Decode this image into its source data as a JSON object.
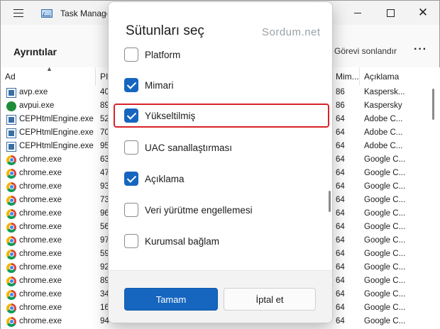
{
  "window": {
    "title": "Task Manage",
    "close_glyph": "✕"
  },
  "toolbar": {
    "section_title": "Ayrıntılar",
    "end_task_label": "Görevi sonlandır",
    "more_label": "···"
  },
  "table": {
    "columns": [
      "Ad",
      "PI",
      "Mim...",
      "Açıklama"
    ],
    "rows": [
      {
        "icon": "box",
        "name": "avp.exe",
        "pid": "40",
        "arch": "86",
        "desc": "Kaspersk..."
      },
      {
        "icon": "k",
        "name": "avpui.exe",
        "pid": "89",
        "arch": "86",
        "desc": "Kaspersky"
      },
      {
        "icon": "box",
        "name": "CEPHtmlEngine.exe",
        "pid": "52",
        "arch": "64",
        "desc": "Adobe C..."
      },
      {
        "icon": "box",
        "name": "CEPHtmlEngine.exe",
        "pid": "70",
        "arch": "64",
        "desc": "Adobe C..."
      },
      {
        "icon": "box",
        "name": "CEPHtmlEngine.exe",
        "pid": "95",
        "arch": "64",
        "desc": "Adobe C..."
      },
      {
        "icon": "chrome",
        "name": "chrome.exe",
        "pid": "63",
        "arch": "64",
        "desc": "Google C..."
      },
      {
        "icon": "chrome",
        "name": "chrome.exe",
        "pid": "47",
        "arch": "64",
        "desc": "Google C..."
      },
      {
        "icon": "chrome",
        "name": "chrome.exe",
        "pid": "93",
        "arch": "64",
        "desc": "Google C..."
      },
      {
        "icon": "chrome",
        "name": "chrome.exe",
        "pid": "73",
        "arch": "64",
        "desc": "Google C..."
      },
      {
        "icon": "chrome",
        "name": "chrome.exe",
        "pid": "96",
        "arch": "64",
        "desc": "Google C..."
      },
      {
        "icon": "chrome",
        "name": "chrome.exe",
        "pid": "56",
        "arch": "64",
        "desc": "Google C..."
      },
      {
        "icon": "chrome",
        "name": "chrome.exe",
        "pid": "97",
        "arch": "64",
        "desc": "Google C..."
      },
      {
        "icon": "chrome",
        "name": "chrome.exe",
        "pid": "59",
        "arch": "64",
        "desc": "Google C..."
      },
      {
        "icon": "chrome",
        "name": "chrome.exe",
        "pid": "92",
        "arch": "64",
        "desc": "Google C..."
      },
      {
        "icon": "chrome",
        "name": "chrome.exe",
        "pid": "89",
        "arch": "64",
        "desc": "Google C..."
      },
      {
        "icon": "chrome",
        "name": "chrome.exe",
        "pid": "34",
        "arch": "64",
        "desc": "Google C..."
      },
      {
        "icon": "chrome",
        "name": "chrome.exe",
        "pid": "16",
        "arch": "64",
        "desc": "Google C..."
      },
      {
        "icon": "chrome",
        "name": "chrome.exe",
        "pid": "94",
        "arch": "64",
        "desc": "Google C..."
      }
    ]
  },
  "dialog": {
    "title": "Sütunları seç",
    "watermark": "Sordum.net",
    "options": [
      {
        "label": "Platform",
        "checked": false
      },
      {
        "label": "Mimari",
        "checked": true
      },
      {
        "label": "Yükseltilmiş",
        "checked": true
      },
      {
        "label": "UAC sanallaştırması",
        "checked": false
      },
      {
        "label": "Açıklama",
        "checked": true
      },
      {
        "label": "Veri yürütme engellemesi",
        "checked": false
      },
      {
        "label": "Kurumsal bağlam",
        "checked": false
      }
    ],
    "ok_label": "Tamam",
    "cancel_label": "İptal et"
  },
  "colors": {
    "accent": "#1666c0",
    "highlight": "#d8232a"
  }
}
